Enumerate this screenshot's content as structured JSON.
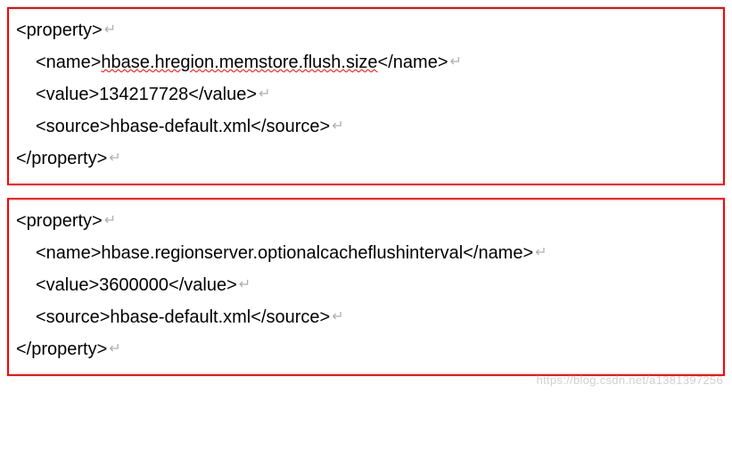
{
  "crlf_symbol": "↵",
  "tag_property_open": "<property>",
  "tag_property_close": "</property>",
  "tag_name_open": "<name>",
  "tag_name_close": "</name>",
  "tag_value_open": "<value>",
  "tag_value_close": "</value>",
  "tag_source_open": "<source>",
  "tag_source_close": "</source>",
  "props": [
    {
      "name": "hbase.hregion.memstore.flush.size",
      "value": "134217728",
      "source": "hbase-default.xml",
      "name_underlined": true
    },
    {
      "name": "hbase.regionserver.optionalcacheflushinterval",
      "value": "3600000",
      "source": "hbase-default.xml",
      "name_underlined": false
    }
  ],
  "watermark": "https://blog.csdn.net/a1381397256"
}
